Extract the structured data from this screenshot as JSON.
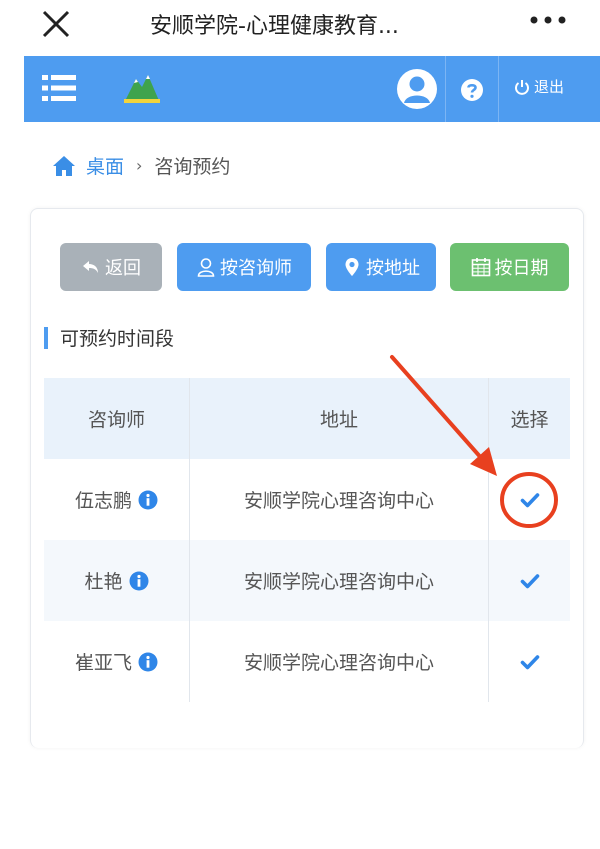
{
  "topbar": {
    "title": "安顺学院-心理健康教育...",
    "close_icon": "close-icon",
    "more_icon": "more-icon"
  },
  "header": {
    "menu_icon": "menu-icon",
    "logo_icon": "logo-icon",
    "avatar_icon": "avatar-icon",
    "help_icon": "help-icon",
    "logout_label": "退出",
    "color": "#4e9cf0"
  },
  "breadcrumb": {
    "home_label": "桌面",
    "separator": "›",
    "current": "咨询预约"
  },
  "buttons": {
    "back": "返回",
    "by_counselor": "按咨询师",
    "by_address": "按地址",
    "by_date": "按日期"
  },
  "section": {
    "title": "可预约时间段"
  },
  "table": {
    "headers": [
      "咨询师",
      "地址",
      "选择"
    ],
    "rows": [
      {
        "counselor": "伍志鹏",
        "address": "安顺学院心理咨询中心"
      },
      {
        "counselor": "杜艳",
        "address": "安顺学院心理咨询中心"
      },
      {
        "counselor": "崔亚飞",
        "address": "安顺学院心理咨询中心"
      }
    ]
  },
  "colors": {
    "primary": "#4e9cf0",
    "back_button": "#a9b1b8",
    "date_button": "#6cc070",
    "annotation": "#e8401f"
  }
}
